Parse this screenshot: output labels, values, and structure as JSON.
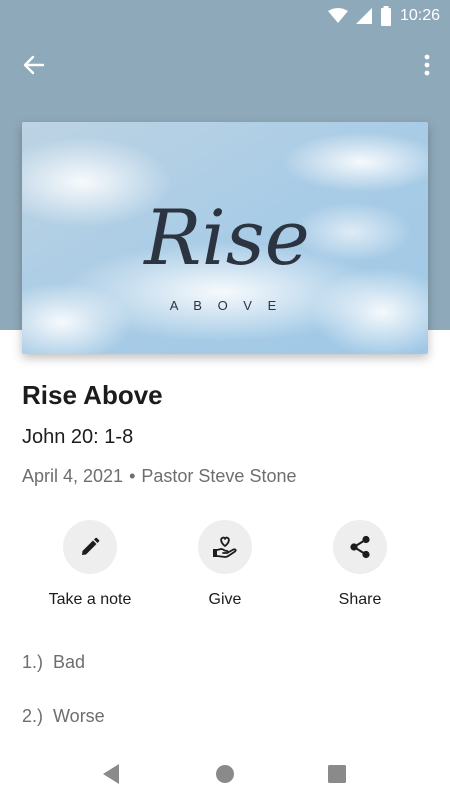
{
  "status_bar": {
    "time": "10:26",
    "icons": [
      "wifi-icon",
      "signal-icon",
      "battery-icon"
    ]
  },
  "app_bar": {
    "icons": [
      "back-arrow-icon",
      "more-vertical-icon"
    ]
  },
  "hero": {
    "script_text": "Rise",
    "subtitle_text": "A B O V E"
  },
  "sermon": {
    "title": "Rise Above",
    "scripture": "John 20: 1-8",
    "date": "April 4, 2021",
    "separator": "•",
    "speaker": "Pastor Steve Stone"
  },
  "actions": [
    {
      "label": "Take a note",
      "icon": "pencil-icon"
    },
    {
      "label": "Give",
      "icon": "heart-hand-icon"
    },
    {
      "label": "Share",
      "icon": "share-icon"
    }
  ],
  "outline": [
    {
      "number": "1.)",
      "text": "Bad"
    },
    {
      "number": "2.)",
      "text": "Worse"
    }
  ],
  "nav_bar": {
    "icons": [
      "back-triangle-icon",
      "home-circle-icon",
      "recents-square-icon"
    ]
  },
  "colors": {
    "header": "#8ea9ba",
    "text_primary": "#1c1c1c",
    "text_secondary": "#6e6e6e",
    "action_bg": "#eeeeee"
  }
}
